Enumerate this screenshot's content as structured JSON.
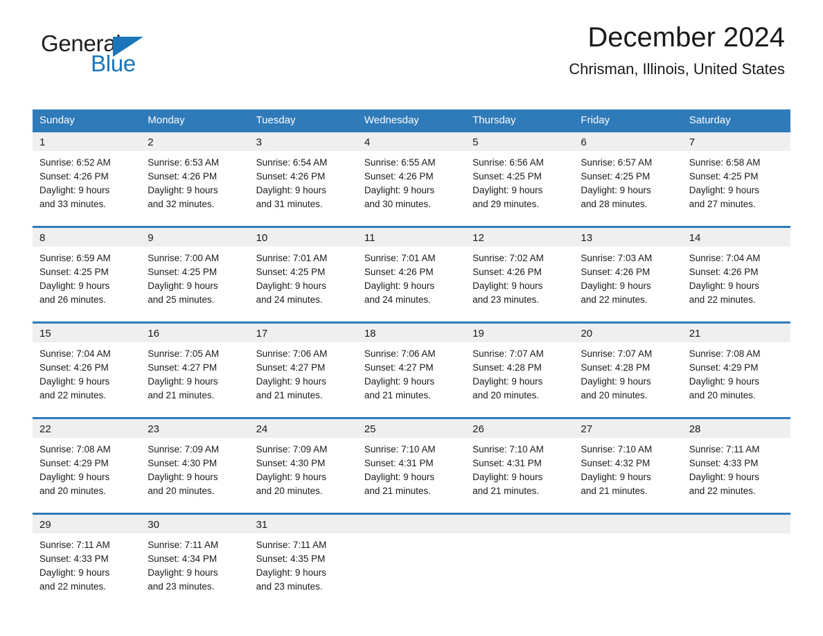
{
  "brand": {
    "word_one": "General",
    "word_two": "Blue",
    "triangle_icon": "triangle-icon",
    "accent_color": "#1b75bb"
  },
  "header": {
    "title": "December 2024",
    "location": "Chrisman, Illinois, United States"
  },
  "calendar": {
    "header_bg": "#2f7ab8",
    "daynum_bg": "#efefef",
    "weekdays": [
      "Sunday",
      "Monday",
      "Tuesday",
      "Wednesday",
      "Thursday",
      "Friday",
      "Saturday"
    ],
    "weeks": [
      {
        "days": [
          {
            "num": "1",
            "sunrise": "Sunrise: 6:52 AM",
            "sunset": "Sunset: 4:26 PM",
            "daylight_1": "Daylight: 9 hours",
            "daylight_2": "and 33 minutes."
          },
          {
            "num": "2",
            "sunrise": "Sunrise: 6:53 AM",
            "sunset": "Sunset: 4:26 PM",
            "daylight_1": "Daylight: 9 hours",
            "daylight_2": "and 32 minutes."
          },
          {
            "num": "3",
            "sunrise": "Sunrise: 6:54 AM",
            "sunset": "Sunset: 4:26 PM",
            "daylight_1": "Daylight: 9 hours",
            "daylight_2": "and 31 minutes."
          },
          {
            "num": "4",
            "sunrise": "Sunrise: 6:55 AM",
            "sunset": "Sunset: 4:26 PM",
            "daylight_1": "Daylight: 9 hours",
            "daylight_2": "and 30 minutes."
          },
          {
            "num": "5",
            "sunrise": "Sunrise: 6:56 AM",
            "sunset": "Sunset: 4:25 PM",
            "daylight_1": "Daylight: 9 hours",
            "daylight_2": "and 29 minutes."
          },
          {
            "num": "6",
            "sunrise": "Sunrise: 6:57 AM",
            "sunset": "Sunset: 4:25 PM",
            "daylight_1": "Daylight: 9 hours",
            "daylight_2": "and 28 minutes."
          },
          {
            "num": "7",
            "sunrise": "Sunrise: 6:58 AM",
            "sunset": "Sunset: 4:25 PM",
            "daylight_1": "Daylight: 9 hours",
            "daylight_2": "and 27 minutes."
          }
        ]
      },
      {
        "days": [
          {
            "num": "8",
            "sunrise": "Sunrise: 6:59 AM",
            "sunset": "Sunset: 4:25 PM",
            "daylight_1": "Daylight: 9 hours",
            "daylight_2": "and 26 minutes."
          },
          {
            "num": "9",
            "sunrise": "Sunrise: 7:00 AM",
            "sunset": "Sunset: 4:25 PM",
            "daylight_1": "Daylight: 9 hours",
            "daylight_2": "and 25 minutes."
          },
          {
            "num": "10",
            "sunrise": "Sunrise: 7:01 AM",
            "sunset": "Sunset: 4:25 PM",
            "daylight_1": "Daylight: 9 hours",
            "daylight_2": "and 24 minutes."
          },
          {
            "num": "11",
            "sunrise": "Sunrise: 7:01 AM",
            "sunset": "Sunset: 4:26 PM",
            "daylight_1": "Daylight: 9 hours",
            "daylight_2": "and 24 minutes."
          },
          {
            "num": "12",
            "sunrise": "Sunrise: 7:02 AM",
            "sunset": "Sunset: 4:26 PM",
            "daylight_1": "Daylight: 9 hours",
            "daylight_2": "and 23 minutes."
          },
          {
            "num": "13",
            "sunrise": "Sunrise: 7:03 AM",
            "sunset": "Sunset: 4:26 PM",
            "daylight_1": "Daylight: 9 hours",
            "daylight_2": "and 22 minutes."
          },
          {
            "num": "14",
            "sunrise": "Sunrise: 7:04 AM",
            "sunset": "Sunset: 4:26 PM",
            "daylight_1": "Daylight: 9 hours",
            "daylight_2": "and 22 minutes."
          }
        ]
      },
      {
        "days": [
          {
            "num": "15",
            "sunrise": "Sunrise: 7:04 AM",
            "sunset": "Sunset: 4:26 PM",
            "daylight_1": "Daylight: 9 hours",
            "daylight_2": "and 22 minutes."
          },
          {
            "num": "16",
            "sunrise": "Sunrise: 7:05 AM",
            "sunset": "Sunset: 4:27 PM",
            "daylight_1": "Daylight: 9 hours",
            "daylight_2": "and 21 minutes."
          },
          {
            "num": "17",
            "sunrise": "Sunrise: 7:06 AM",
            "sunset": "Sunset: 4:27 PM",
            "daylight_1": "Daylight: 9 hours",
            "daylight_2": "and 21 minutes."
          },
          {
            "num": "18",
            "sunrise": "Sunrise: 7:06 AM",
            "sunset": "Sunset: 4:27 PM",
            "daylight_1": "Daylight: 9 hours",
            "daylight_2": "and 21 minutes."
          },
          {
            "num": "19",
            "sunrise": "Sunrise: 7:07 AM",
            "sunset": "Sunset: 4:28 PM",
            "daylight_1": "Daylight: 9 hours",
            "daylight_2": "and 20 minutes."
          },
          {
            "num": "20",
            "sunrise": "Sunrise: 7:07 AM",
            "sunset": "Sunset: 4:28 PM",
            "daylight_1": "Daylight: 9 hours",
            "daylight_2": "and 20 minutes."
          },
          {
            "num": "21",
            "sunrise": "Sunrise: 7:08 AM",
            "sunset": "Sunset: 4:29 PM",
            "daylight_1": "Daylight: 9 hours",
            "daylight_2": "and 20 minutes."
          }
        ]
      },
      {
        "days": [
          {
            "num": "22",
            "sunrise": "Sunrise: 7:08 AM",
            "sunset": "Sunset: 4:29 PM",
            "daylight_1": "Daylight: 9 hours",
            "daylight_2": "and 20 minutes."
          },
          {
            "num": "23",
            "sunrise": "Sunrise: 7:09 AM",
            "sunset": "Sunset: 4:30 PM",
            "daylight_1": "Daylight: 9 hours",
            "daylight_2": "and 20 minutes."
          },
          {
            "num": "24",
            "sunrise": "Sunrise: 7:09 AM",
            "sunset": "Sunset: 4:30 PM",
            "daylight_1": "Daylight: 9 hours",
            "daylight_2": "and 20 minutes."
          },
          {
            "num": "25",
            "sunrise": "Sunrise: 7:10 AM",
            "sunset": "Sunset: 4:31 PM",
            "daylight_1": "Daylight: 9 hours",
            "daylight_2": "and 21 minutes."
          },
          {
            "num": "26",
            "sunrise": "Sunrise: 7:10 AM",
            "sunset": "Sunset: 4:31 PM",
            "daylight_1": "Daylight: 9 hours",
            "daylight_2": "and 21 minutes."
          },
          {
            "num": "27",
            "sunrise": "Sunrise: 7:10 AM",
            "sunset": "Sunset: 4:32 PM",
            "daylight_1": "Daylight: 9 hours",
            "daylight_2": "and 21 minutes."
          },
          {
            "num": "28",
            "sunrise": "Sunrise: 7:11 AM",
            "sunset": "Sunset: 4:33 PM",
            "daylight_1": "Daylight: 9 hours",
            "daylight_2": "and 22 minutes."
          }
        ]
      },
      {
        "days": [
          {
            "num": "29",
            "sunrise": "Sunrise: 7:11 AM",
            "sunset": "Sunset: 4:33 PM",
            "daylight_1": "Daylight: 9 hours",
            "daylight_2": "and 22 minutes."
          },
          {
            "num": "30",
            "sunrise": "Sunrise: 7:11 AM",
            "sunset": "Sunset: 4:34 PM",
            "daylight_1": "Daylight: 9 hours",
            "daylight_2": "and 23 minutes."
          },
          {
            "num": "31",
            "sunrise": "Sunrise: 7:11 AM",
            "sunset": "Sunset: 4:35 PM",
            "daylight_1": "Daylight: 9 hours",
            "daylight_2": "and 23 minutes."
          },
          {
            "num": "",
            "sunrise": "",
            "sunset": "",
            "daylight_1": "",
            "daylight_2": ""
          },
          {
            "num": "",
            "sunrise": "",
            "sunset": "",
            "daylight_1": "",
            "daylight_2": ""
          },
          {
            "num": "",
            "sunrise": "",
            "sunset": "",
            "daylight_1": "",
            "daylight_2": ""
          },
          {
            "num": "",
            "sunrise": "",
            "sunset": "",
            "daylight_1": "",
            "daylight_2": ""
          }
        ]
      }
    ]
  }
}
